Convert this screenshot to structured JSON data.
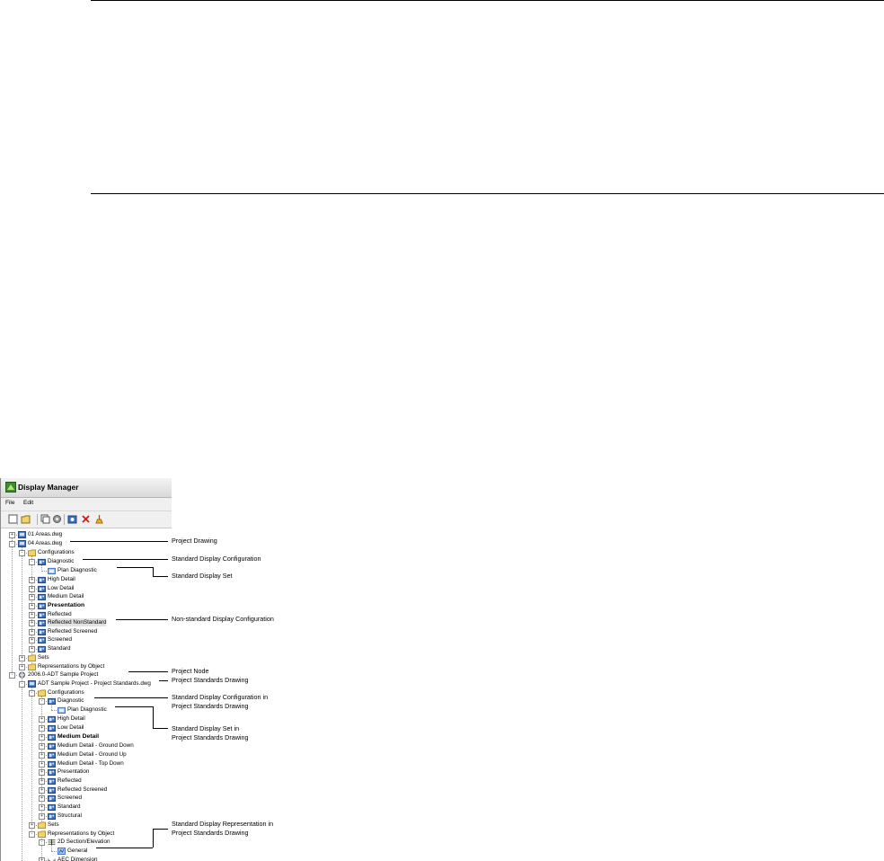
{
  "window": {
    "title": "Display Manager",
    "menu": [
      "File",
      "Edit"
    ]
  },
  "toolbar_icons": [
    "new-icon",
    "open-icon",
    "copy-icon",
    "gear-icon",
    "purge-icon",
    "delete-icon",
    "sweep-icon"
  ],
  "tree": [
    {
      "label": "01 Areas.dwg",
      "icon": "drawing-icon",
      "expand": "+"
    },
    {
      "label": "04 Areas.dwg",
      "icon": "drawing-icon",
      "expand": "-"
    },
    {
      "label": "Configurations",
      "icon": "folder-icon",
      "expand": "-"
    },
    {
      "label": "Diagnostic",
      "icon": "config-icon",
      "expand": "-"
    },
    {
      "label": "Plan Diagnostic",
      "icon": "set-icon",
      "expand": ""
    },
    {
      "label": "High Detail",
      "icon": "config-icon",
      "expand": "+"
    },
    {
      "label": "Low Detail",
      "icon": "config-icon",
      "expand": "+"
    },
    {
      "label": "Medium Detail",
      "icon": "config-icon",
      "expand": "+"
    },
    {
      "label": "Presentation",
      "icon": "config-icon",
      "expand": "+",
      "bold": true
    },
    {
      "label": "Reflected",
      "icon": "config-icon",
      "expand": "+"
    },
    {
      "label": "Reflected NonStandard",
      "icon": "config-icon",
      "expand": "+",
      "selected": true
    },
    {
      "label": "Reflected Screened",
      "icon": "config-icon",
      "expand": "+"
    },
    {
      "label": "Screened",
      "icon": "config-icon",
      "expand": "+"
    },
    {
      "label": "Standard",
      "icon": "config-icon",
      "expand": "+"
    },
    {
      "label": "Sets",
      "icon": "folder-icon",
      "expand": "+"
    },
    {
      "label": "Representations by Object",
      "icon": "folder-icon",
      "expand": "+"
    },
    {
      "label": "2006.0-ADT Sample Project",
      "icon": "project-icon",
      "expand": "-"
    },
    {
      "label": "ADT Sample Project - Project Standards.dwg",
      "icon": "drawing-icon",
      "expand": "-"
    },
    {
      "label": "Configurations",
      "icon": "folder-icon",
      "expand": "-"
    },
    {
      "label": "Diagnostic",
      "icon": "config-icon",
      "expand": "-"
    },
    {
      "label": "Plan Diagnostic",
      "icon": "set-icon",
      "expand": ""
    },
    {
      "label": "High Detail",
      "icon": "config-icon",
      "expand": "+"
    },
    {
      "label": "Low Detail",
      "icon": "config-icon",
      "expand": "+"
    },
    {
      "label": "Medium Detail",
      "icon": "config-icon",
      "expand": "+",
      "bold": true
    },
    {
      "label": "Medium Detail - Ground Down",
      "icon": "config-icon",
      "expand": "+"
    },
    {
      "label": "Medium Detail - Ground Up",
      "icon": "config-icon",
      "expand": "+"
    },
    {
      "label": "Medium Detail - Top Down",
      "icon": "config-icon",
      "expand": "+"
    },
    {
      "label": "Presentation",
      "icon": "config-icon",
      "expand": "+"
    },
    {
      "label": "Reflected",
      "icon": "config-icon",
      "expand": "+"
    },
    {
      "label": "Reflected Screened",
      "icon": "config-icon",
      "expand": "+"
    },
    {
      "label": "Screened",
      "icon": "config-icon",
      "expand": "+"
    },
    {
      "label": "Standard",
      "icon": "config-icon",
      "expand": "+"
    },
    {
      "label": "Structural",
      "icon": "config-icon",
      "expand": "+"
    },
    {
      "label": "Sets",
      "icon": "folder-icon",
      "expand": "+"
    },
    {
      "label": "Representations by Object",
      "icon": "folder-icon",
      "expand": "-"
    },
    {
      "label": "2D Section/Elevation",
      "icon": "section-icon",
      "expand": "-"
    },
    {
      "label": "General",
      "icon": "rep-icon",
      "expand": ""
    },
    {
      "label": "AEC Dimension",
      "icon": "dimension-icon",
      "expand": "+"
    }
  ],
  "callouts": {
    "project_drawing": "Project Drawing",
    "std_display_config": "Standard Display Configuration",
    "std_display_set": "Standard Display Set",
    "nonstd_display_config": "Non-standard Display Configuration",
    "project_node": "Project Node",
    "project_standards_drawing": "Project Standards Drawing",
    "std_config_in_line1": "Standard Display Configuration in",
    "std_config_in_line2": "Project Standards Drawing",
    "std_set_in_line1": "Standard Display Set in",
    "std_set_in_line2": "Project Standards Drawing",
    "std_rep_in_line1": "Standard Display Representation in",
    "std_rep_in_line2": "Project Standards Drawing"
  },
  "colors": {
    "icon_blue": "#3a6fc4",
    "folder": "#f2d36b",
    "delete_red": "#d01818"
  }
}
